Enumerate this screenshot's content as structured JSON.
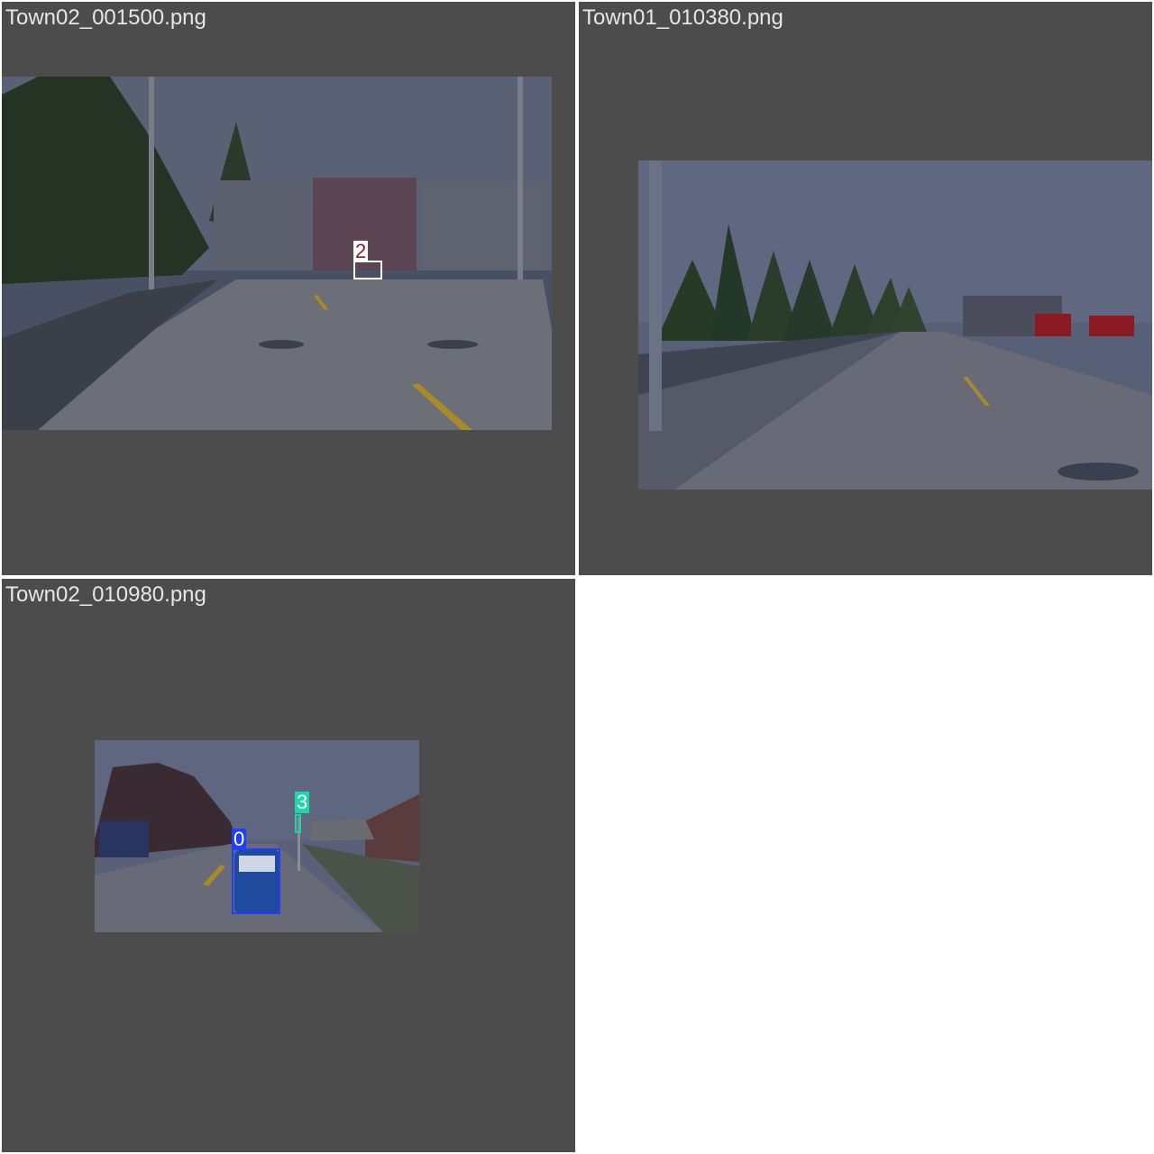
{
  "tiles": [
    {
      "filename": "Town02_001500.png",
      "detections": [
        {
          "label": "2",
          "color": "#ffffff",
          "label_text_color": "#8b1a1a"
        }
      ]
    },
    {
      "filename": "Town01_010380.png",
      "detections": []
    },
    {
      "filename": "Town02_010980.png",
      "detections": [
        {
          "label": "0",
          "color": "#1f3fff",
          "label_text_color": "#ffffff"
        },
        {
          "label": "3",
          "color": "#1fd6a8",
          "label_text_color": "#ffffff"
        }
      ]
    }
  ],
  "colors": {
    "page_background": "#ffffff",
    "tile_background": "#4c4c4c",
    "title_text": "#e6e6e6"
  }
}
